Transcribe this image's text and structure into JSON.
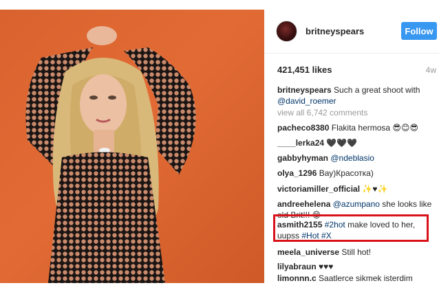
{
  "post": {
    "author": "britneyspears",
    "follow_label": "Follow",
    "likes": "421,451 likes",
    "age": "4w",
    "caption_user": "britneyspears",
    "caption_text": "Such a great shoot with",
    "caption_mention": "@david_roemer",
    "view_all": "view all 6,742 comments"
  },
  "comments": [
    {
      "user": "pacheco8380",
      "text": "Flakita hermosa 😎😊😎"
    },
    {
      "user": "____lerka24",
      "text": "🖤🖤🖤"
    },
    {
      "user": "gabbyhyman",
      "tag": "@ndeblasio"
    },
    {
      "user": "olya_1296",
      "text": "Вау)Красотка)"
    },
    {
      "user": "victoriamiller_official",
      "text": "✨♥✨"
    },
    {
      "user": "andreehelena",
      "tag": "@azumpano",
      "text": "she looks like old Brit!!! 😊"
    },
    {
      "user": "asmith2155",
      "tag": "#2hot",
      "text": "make loved to her, uupss",
      "tag2": "#Hot #X"
    },
    {
      "user": "meela_universe",
      "text": "Still hot!"
    },
    {
      "user": "lilyabraun",
      "text": "♥♥♥"
    },
    {
      "user": "limonnn.c",
      "text": "Saatlerce sikmek isterdim"
    }
  ],
  "colors": {
    "follow_button": "#3897f0",
    "highlight_box": "#d9121a",
    "photo_background": "#e0652f"
  }
}
